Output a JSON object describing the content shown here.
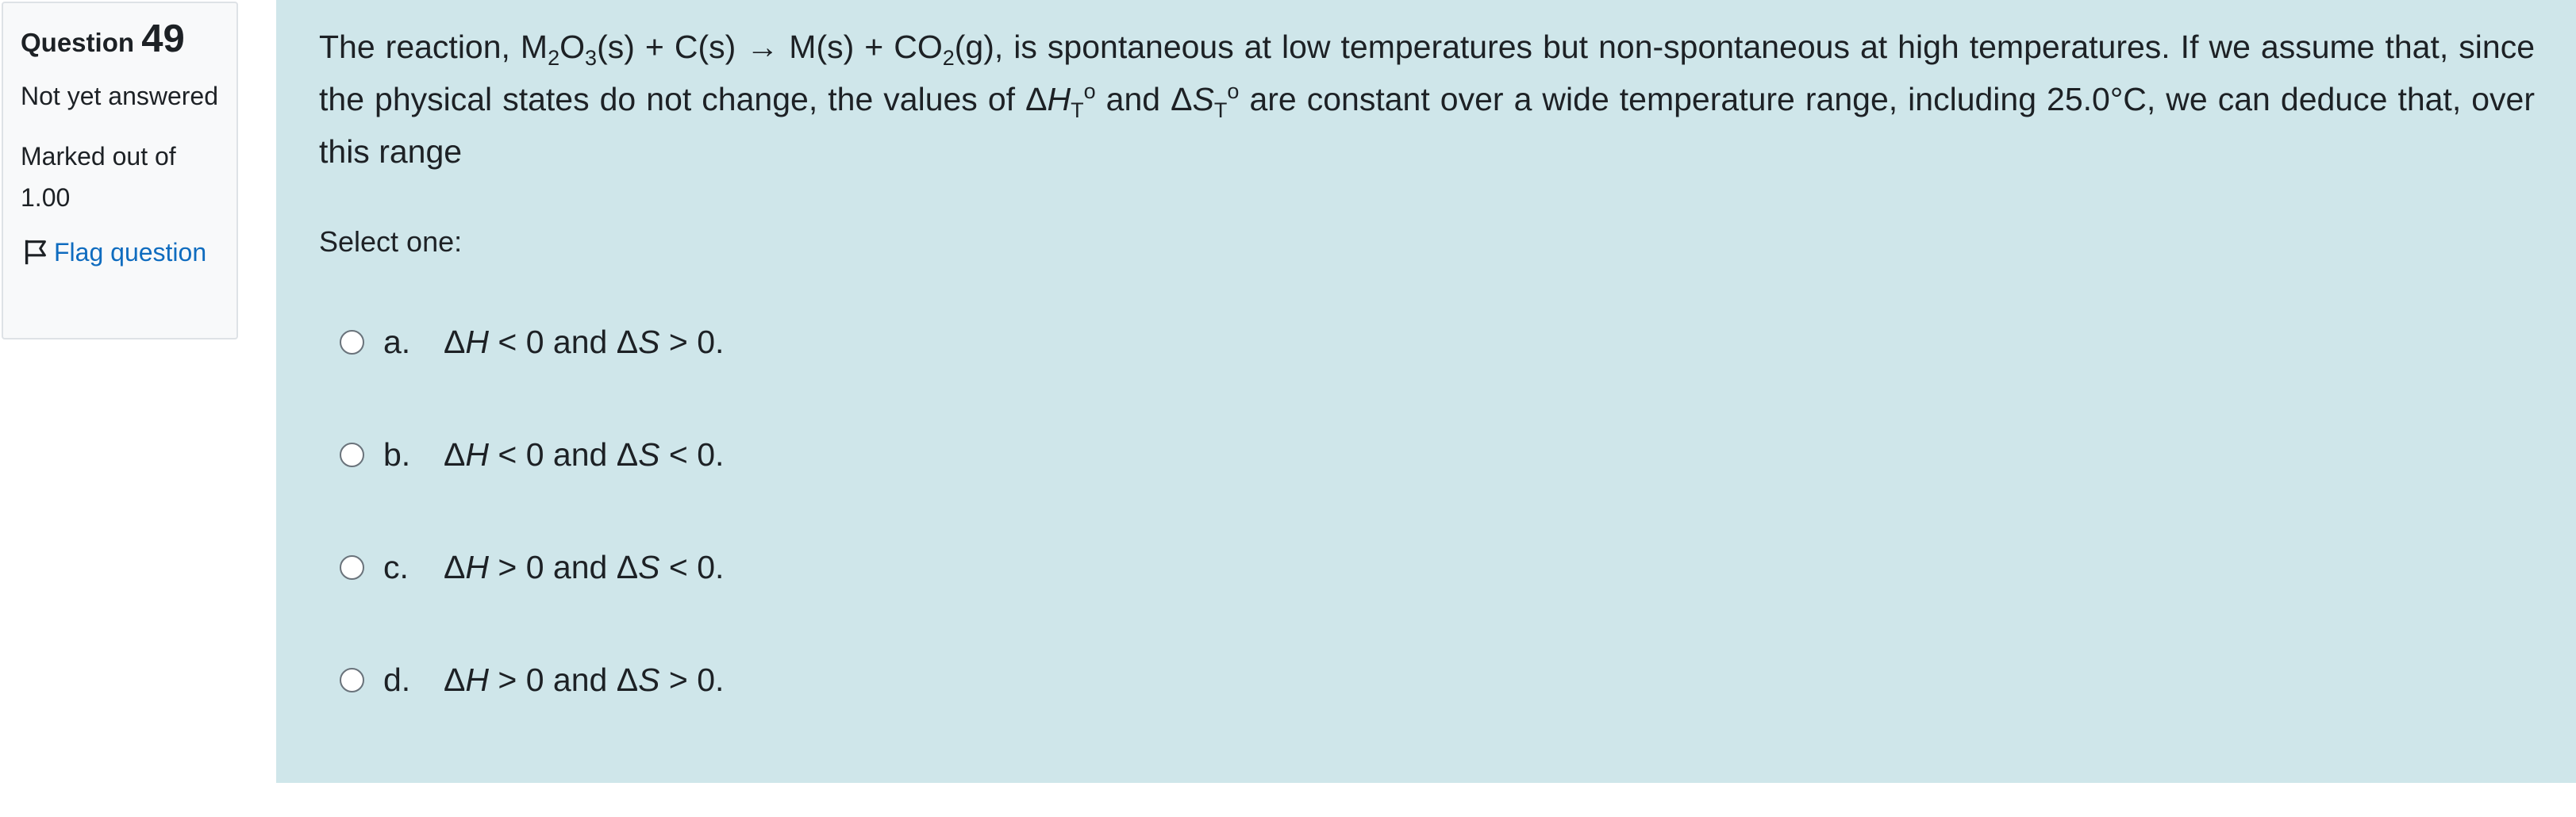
{
  "info": {
    "question_label": "Question",
    "question_number": "49",
    "state": "Not yet answered",
    "grade": "Marked out of 1.00",
    "flag_label": "Flag question"
  },
  "question": {
    "text_parts": {
      "p1": "The reaction, M",
      "s1": "2",
      "p2": "O",
      "s2": "3",
      "p3": "(s) + C(s) → M(s) + CO",
      "s3": "2",
      "p4": "(g), is spontaneous at low temperatures but non-spontaneous at high temperatures. If we assume that, since the physical states do not change, the values of Δ",
      "h": "H",
      "t1": "T",
      "o1": "o",
      "p5": " and Δ",
      "s": "S",
      "t2": "T",
      "o2": "o",
      "p6": " are constant over a wide temperature range, including 25.0°C, we can deduce that, over this range"
    },
    "prompt": "Select one:",
    "answers": [
      {
        "letter": "a.",
        "d1": "Δ",
        "v1": "H",
        "r1": " < 0 and Δ",
        "v2": "S",
        "r2": " > 0."
      },
      {
        "letter": "b.",
        "d1": "Δ",
        "v1": "H",
        "r1": " < 0 and Δ",
        "v2": "S",
        "r2": " < 0."
      },
      {
        "letter": "c.",
        "d1": "Δ",
        "v1": "H",
        "r1": " > 0 and Δ",
        "v2": "S",
        "r2": " < 0."
      },
      {
        "letter": "d.",
        "d1": "Δ",
        "v1": "H",
        "r1": " > 0 and Δ",
        "v2": "S",
        "r2": " > 0."
      }
    ]
  },
  "colors": {
    "info_bg": "#f8f9fa",
    "formulation_bg": "#cfe6ea",
    "link": "#0f6cbf"
  },
  "icons": {
    "flag": "flag-outline-icon"
  }
}
